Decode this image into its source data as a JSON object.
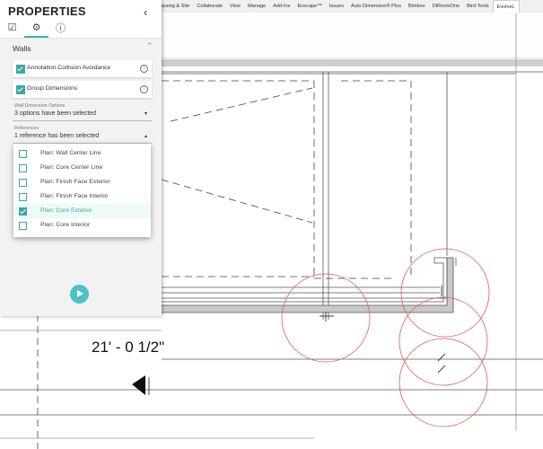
{
  "ribbon": {
    "tabs": [
      "Massing & Site",
      "Collaborate",
      "View",
      "Manage",
      "Add-Ins",
      "Enscape™",
      "Issues",
      "Auto Dimension® Plus",
      "Bimbox",
      "DiRootsOne",
      "Bird Tools",
      "EvolveL"
    ],
    "active_tab": "EvolveL"
  },
  "drawing": {
    "dimension_text": "21' - 0 1/2\""
  },
  "panel": {
    "title": "PROPERTIES",
    "collapse_icon": "‹",
    "tabs": [
      {
        "icon": "checklist-icon",
        "glyph": "☑"
      },
      {
        "icon": "gear-icon",
        "glyph": "⚙"
      },
      {
        "icon": "info-icon",
        "glyph": "ⓘ"
      }
    ],
    "section": {
      "label": "Walls",
      "chevron": "⌃"
    },
    "options": [
      {
        "label": "Annotation Collision Avoidance",
        "checked": true,
        "info": "i"
      },
      {
        "label": "Group Dimensions",
        "checked": true,
        "info": "i"
      }
    ],
    "wall_dimension_options": {
      "label": "Wall Dimension Options",
      "value": "3 options have been selected",
      "caret": "▾"
    },
    "references": {
      "label": "References",
      "value": "1 reference has been selected",
      "caret": "▴",
      "items": [
        {
          "label": "Plan: Wall Center Line",
          "checked": false
        },
        {
          "label": "Plan: Core Center Line",
          "checked": false
        },
        {
          "label": "Plan: Finish Face Exterior",
          "checked": false
        },
        {
          "label": "Plan: Finish Face Interior",
          "checked": false
        },
        {
          "label": "Plan: Core Exterior",
          "checked": true
        },
        {
          "label": "Plan: Core Interior",
          "checked": false
        }
      ]
    }
  },
  "colors": {
    "accent": "#3aa9a0",
    "run_button": "#4cc1c8",
    "circle": "#e05a5a"
  }
}
